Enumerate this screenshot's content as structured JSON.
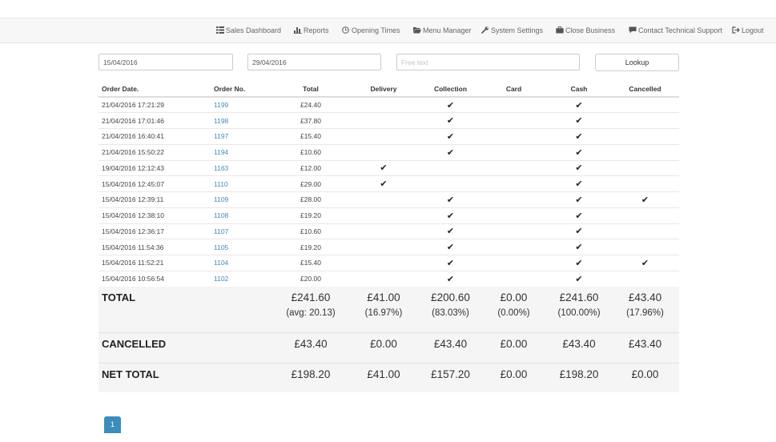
{
  "nav": {
    "sales_dashboard": "Sales Dashboard",
    "reports": "Reports",
    "opening_times": "Opening Times",
    "menu_manager": "Menu Manager",
    "system_settings": "System Settings",
    "close_business": "Close Business",
    "contact_support": "Contact Technical Support",
    "logout": "Logout"
  },
  "filters": {
    "date_from": "15/04/2016",
    "date_to": "29/04/2016",
    "free_text_placeholder": "Free text",
    "lookup_label": "Lookup"
  },
  "table": {
    "headers": [
      "Order Date.",
      "Order No.",
      "Total",
      "Delivery",
      "Collection",
      "Card",
      "Cash",
      "Cancelled"
    ],
    "check_glyph": "✔",
    "rows": [
      {
        "date": "21/04/2016 17:21:29",
        "order_no": "1199",
        "total": "£24.40",
        "delivery": false,
        "collection": true,
        "card": false,
        "cash": true,
        "cancelled": false
      },
      {
        "date": "21/04/2016 17:01:46",
        "order_no": "1198",
        "total": "£37.80",
        "delivery": false,
        "collection": true,
        "card": false,
        "cash": true,
        "cancelled": false
      },
      {
        "date": "21/04/2016 16:40:41",
        "order_no": "1197",
        "total": "£15.40",
        "delivery": false,
        "collection": true,
        "card": false,
        "cash": true,
        "cancelled": false
      },
      {
        "date": "21/04/2016 15:50:22",
        "order_no": "1194",
        "total": "£10.60",
        "delivery": false,
        "collection": true,
        "card": false,
        "cash": true,
        "cancelled": false
      },
      {
        "date": "19/04/2016 12:12:43",
        "order_no": "1163",
        "total": "£12.00",
        "delivery": true,
        "collection": false,
        "card": false,
        "cash": true,
        "cancelled": false
      },
      {
        "date": "15/04/2016 12:45:07",
        "order_no": "1110",
        "total": "£29.00",
        "delivery": true,
        "collection": false,
        "card": false,
        "cash": true,
        "cancelled": false
      },
      {
        "date": "15/04/2016 12:39:11",
        "order_no": "1109",
        "total": "£28.00",
        "delivery": false,
        "collection": true,
        "card": false,
        "cash": true,
        "cancelled": true
      },
      {
        "date": "15/04/2016 12:38:10",
        "order_no": "1108",
        "total": "£19.20",
        "delivery": false,
        "collection": true,
        "card": false,
        "cash": true,
        "cancelled": false
      },
      {
        "date": "15/04/2016 12:36:17",
        "order_no": "1107",
        "total": "£10.60",
        "delivery": false,
        "collection": true,
        "card": false,
        "cash": true,
        "cancelled": false
      },
      {
        "date": "15/04/2016 11:54:36",
        "order_no": "1105",
        "total": "£19.20",
        "delivery": false,
        "collection": true,
        "card": false,
        "cash": true,
        "cancelled": false
      },
      {
        "date": "15/04/2016 11:52:21",
        "order_no": "1104",
        "total": "£15.40",
        "delivery": false,
        "collection": true,
        "card": false,
        "cash": true,
        "cancelled": true
      },
      {
        "date": "15/04/2016 10:56:54",
        "order_no": "1102",
        "total": "£20.00",
        "delivery": false,
        "collection": true,
        "card": false,
        "cash": true,
        "cancelled": false
      }
    ]
  },
  "summary": {
    "total": {
      "label": "TOTAL",
      "total": "£241.60",
      "total_sub": "(avg: 20.13)",
      "delivery": "£41.00",
      "delivery_sub": "(16.97%)",
      "collection": "£200.60",
      "collection_sub": "(83.03%)",
      "card": "£0.00",
      "card_sub": "(0.00%)",
      "cash": "£241.60",
      "cash_sub": "(100.00%)",
      "cancelled": "£43.40",
      "cancelled_sub": "(17.96%)"
    },
    "cancelled": {
      "label": "CANCELLED",
      "total": "£43.40",
      "delivery": "£0.00",
      "collection": "£43.40",
      "card": "£0.00",
      "cash": "£43.40",
      "cancelled": "£43.40"
    },
    "net": {
      "label": "NET TOTAL",
      "total": "£198.20",
      "delivery": "£41.00",
      "collection": "£157.20",
      "card": "£0.00",
      "cash": "£198.20",
      "cancelled": "£0.00"
    }
  },
  "pagination": {
    "current_page": "1"
  },
  "colors": {
    "accent": "#3c8dbc",
    "nav_background": "#f7f7f7",
    "summary_background": "#f5f5f5"
  }
}
